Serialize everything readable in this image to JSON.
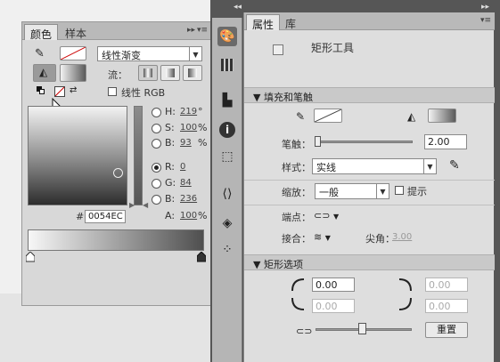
{
  "color_panel": {
    "tabs": [
      {
        "label": "颜色"
      },
      {
        "label": "样本"
      }
    ],
    "type_dropdown": "线性渐变",
    "flow_label": "流：",
    "linear_rgb_label": "线性 RGB",
    "hsb": [
      {
        "label": "H:",
        "value": "219",
        "unit": "°"
      },
      {
        "label": "S:",
        "value": "100",
        "unit": "%"
      },
      {
        "label": "B:",
        "value": "93",
        "unit": "%"
      }
    ],
    "rgb": [
      {
        "label": "R:",
        "value": "0"
      },
      {
        "label": "G:",
        "value": "84"
      },
      {
        "label": "B:",
        "value": "236"
      }
    ],
    "alpha": {
      "label": "A:",
      "value": "100",
      "unit": "%"
    },
    "hex_label": "#",
    "hex_value": "0054EC"
  },
  "properties_panel": {
    "tabs": [
      {
        "label": "属性"
      },
      {
        "label": "库"
      }
    ],
    "tool_name": "矩形工具",
    "fill_stroke_header": "填充和笔触",
    "stroke_label": "笔触：",
    "stroke_value": "2.00",
    "style_label": "样式：",
    "style_value": "实线",
    "scale_label": "缩放：",
    "scale_value": "一般",
    "hint_label": "提示",
    "cap_label": "端点：",
    "join_label": "接合：",
    "miter_label": "尖角：",
    "miter_value": "3.00",
    "rect_options_header": "矩形选项",
    "corner_values": [
      "0.00",
      "0.00",
      "0.00",
      "0.00"
    ],
    "reset_label": "重置"
  }
}
